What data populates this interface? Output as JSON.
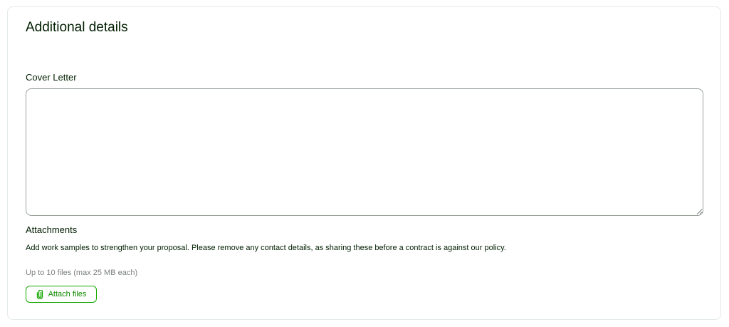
{
  "section": {
    "title": "Additional details"
  },
  "cover_letter": {
    "label": "Cover Letter",
    "value": "",
    "placeholder": ""
  },
  "attachments": {
    "title": "Attachments",
    "description": "Add work samples to strengthen your proposal. Please remove any contact details, as sharing these before a contract is against our policy.",
    "limit_note": "Up to 10 files (max 25 MB each)",
    "button_label": "Attach files",
    "button_icon": "paperclip-icon"
  },
  "colors": {
    "accent": "#14a800",
    "accent_text": "#108a00",
    "text": "#001e00",
    "muted_text": "#7a807a",
    "border": "#e4ebe4",
    "input_border": "#9aa29a"
  }
}
